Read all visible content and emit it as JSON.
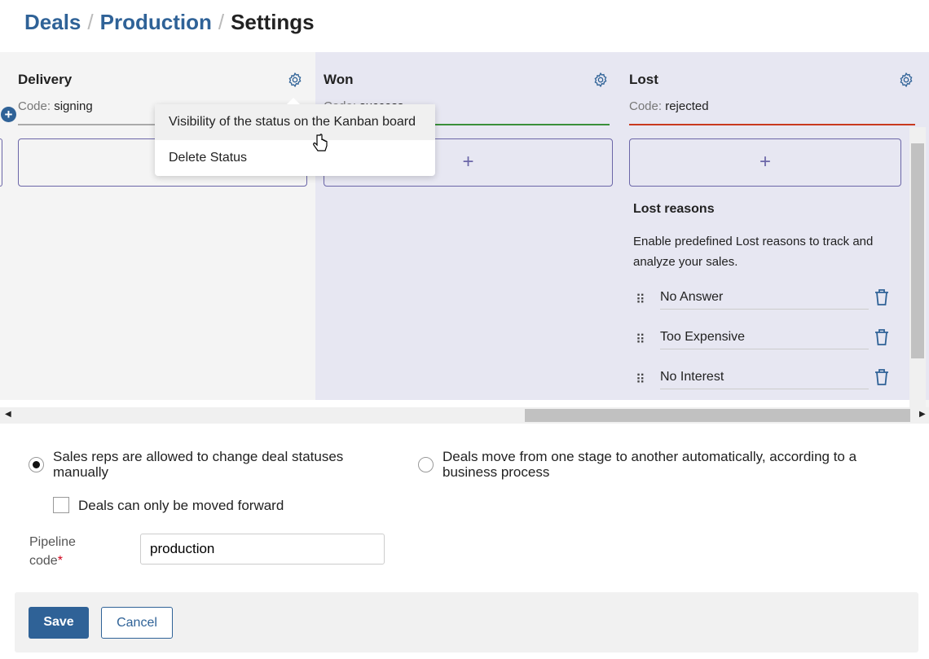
{
  "breadcrumb": {
    "items": [
      "Deals",
      "Production"
    ],
    "current": "Settings"
  },
  "columns": [
    {
      "title": "Delivery",
      "code_label": "Code:",
      "code": "signing",
      "color": "#aaaaaa"
    },
    {
      "title": "Won",
      "code_label": "Code:",
      "code": "success",
      "color": "#3a8f3a"
    },
    {
      "title": "Lost",
      "code_label": "Code:",
      "code": "rejected",
      "color": "#c9391f"
    }
  ],
  "add_symbol": "+",
  "context_menu": {
    "items": [
      "Visibility of the status on the Kanban board",
      "Delete Status"
    ]
  },
  "lost_reasons": {
    "title": "Lost reasons",
    "description": "Enable predefined Lost reasons to track and analyze your sales.",
    "items": [
      "No Answer",
      "Too Expensive",
      "No Interest"
    ]
  },
  "options": {
    "manual": "Sales reps are allowed to change deal statuses manually",
    "auto": "Deals move from one stage to another automatically, according to a business process",
    "selected": "manual",
    "forward_only": "Deals can only be moved forward",
    "forward_only_checked": false
  },
  "pipeline_code": {
    "label": "Pipeline code",
    "required_mark": "*",
    "value": "production"
  },
  "buttons": {
    "save": "Save",
    "cancel": "Cancel"
  },
  "colors": {
    "accent": "#2f6297",
    "required": "#d0021b"
  }
}
